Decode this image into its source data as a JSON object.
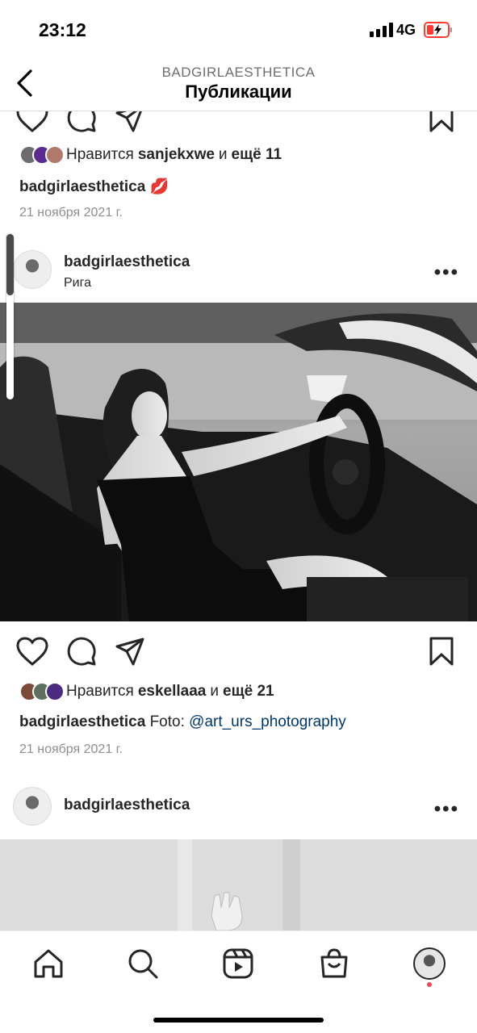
{
  "status_bar": {
    "time": "23:12",
    "network": "4G"
  },
  "header": {
    "account": "BADGIRLAESTHETICA",
    "title": "Публикации"
  },
  "posts": [
    {
      "likes": {
        "prefix": "Нравится",
        "user": "sanjekxwe",
        "and": "и",
        "more": "ещё 11"
      },
      "caption": {
        "user": "badgirlaesthetica",
        "text": "💋"
      },
      "date": "21 ноября 2021 г."
    },
    {
      "user": "badgirlaesthetica",
      "location": "Рига",
      "likes": {
        "prefix": "Нравится",
        "user": "eskellaaa",
        "and": "и",
        "more": "ещё 21"
      },
      "caption": {
        "user": "badgirlaesthetica",
        "text": "Foto:",
        "mention": "@art_urs_photography"
      },
      "date": "21 ноября 2021 г."
    },
    {
      "user": "badgirlaesthetica"
    }
  ],
  "icons": [
    "back-icon",
    "heart-icon",
    "comment-icon",
    "share-icon",
    "bookmark-icon",
    "more-icon",
    "home-icon",
    "search-icon",
    "reels-icon",
    "shop-icon",
    "profile-avatar"
  ],
  "colors": {
    "text": "#262626",
    "secondary": "#8e8e8e",
    "mention": "#00376b",
    "notification": "#ed4956"
  }
}
